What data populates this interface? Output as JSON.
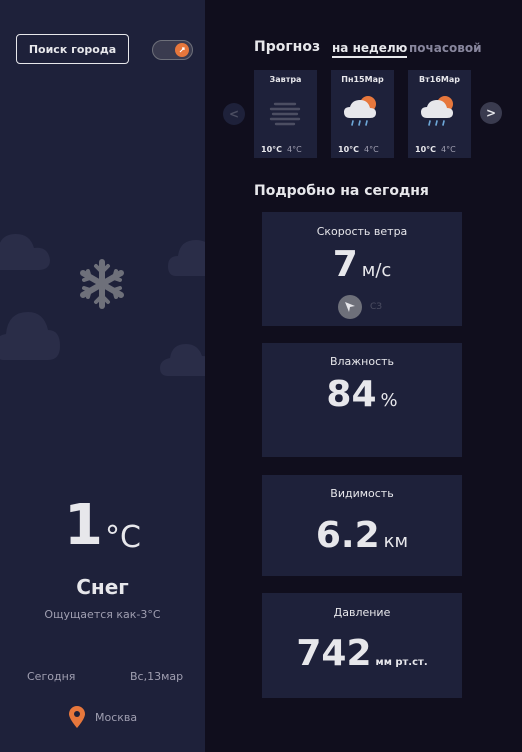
{
  "left": {
    "search_button": "Поиск города",
    "temp_value": "1",
    "temp_unit": "°C",
    "condition": "Снег",
    "feels_like": "Ощущается как-3°C",
    "today": "Сегодня",
    "date": "Вс,13мар",
    "location": "Москва",
    "icons": {
      "search_toggle": "toggle-icon",
      "weather": "snowflake-icon",
      "location": "location-pin-icon"
    }
  },
  "forecast": {
    "title": "Прогноз",
    "tab_week": "на неделю",
    "tab_hourly": "почасовой",
    "cards": [
      {
        "day": "Завтра",
        "icon": "fog-icon",
        "max": "10°C",
        "min": "4°C"
      },
      {
        "day": "Пн15Мар",
        "icon": "sun-rain-cloud-icon",
        "max": "10°C",
        "min": "4°C"
      },
      {
        "day": "Вт16Мар",
        "icon": "sun-rain-cloud-icon",
        "max": "10°C",
        "min": "4°C"
      }
    ],
    "prev": "<",
    "next": ">"
  },
  "highlights": {
    "title": "Подробно на сегодня",
    "wind": {
      "label": "Скорость ветра",
      "value": "7",
      "unit": "м/с",
      "direction": "СЗ"
    },
    "humidity": {
      "label": "Влажность",
      "value": "84",
      "unit": "%"
    },
    "visibility": {
      "label": "Видимость",
      "value": "6.2",
      "unit": "км"
    },
    "pressure": {
      "label": "Давление",
      "value": "742",
      "unit": "мм рт.ст."
    }
  },
  "colors": {
    "background": "#100e1d",
    "panel": "#1e213a",
    "accent": "#e7773c",
    "text": "#e7e7eb",
    "muted": "#a09fb1"
  }
}
